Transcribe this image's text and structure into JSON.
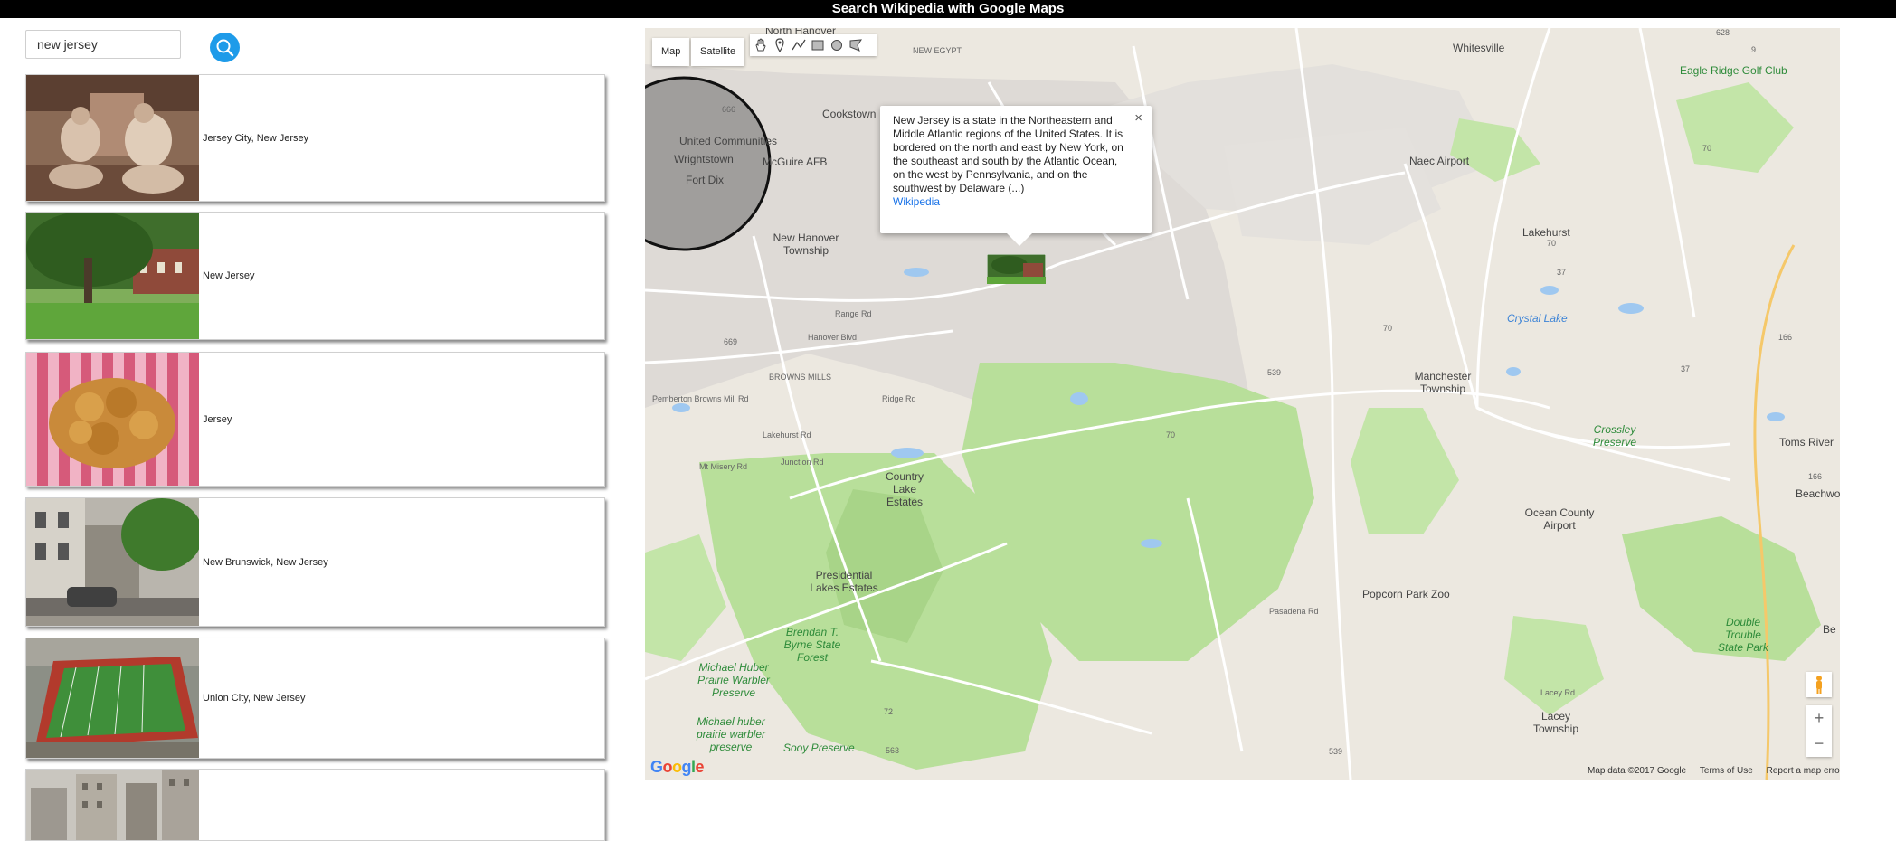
{
  "app": {
    "title": "Search Wikipedia with Google Maps"
  },
  "search": {
    "value": "new jersey",
    "button_icon": "search-icon"
  },
  "results": [
    {
      "label": "Jersey City, New Jersey",
      "thumb": "sepia-family-photo"
    },
    {
      "label": "New Jersey",
      "thumb": "tree-lawn-photo"
    },
    {
      "label": "Jersey",
      "thumb": "fried-food-photo"
    },
    {
      "label": "New Brunswick, New Jersey",
      "thumb": "street-photo"
    },
    {
      "label": "Union City, New Jersey",
      "thumb": "stadium-aerial-photo"
    },
    {
      "label": "",
      "thumb": "city-buildings-photo"
    }
  ],
  "map": {
    "type_controls": {
      "map": "Map",
      "satellite": "Satellite",
      "selected": "Map"
    },
    "draw_tools": [
      "hand-icon",
      "marker-icon",
      "polyline-icon",
      "rectangle-icon",
      "circle-icon",
      "polygon-icon"
    ],
    "infowindow": {
      "text": "New Jersey is a state in the Northeastern and Middle Atlantic regions of the United States. It is bordered on the north and east by New York, on the southeast and south by the Atlantic Ocean, on the west by Pennsylvania, and on the southwest by Delaware (...)",
      "link": "Wikipedia",
      "close": "×"
    },
    "labels": {
      "north_hanover": "North Hanover",
      "new_egypt": "NEW EGYPT",
      "cookstown": "Cookstown",
      "united_communities": "United Communities",
      "wrightstown": "Wrightstown",
      "mcguire": "McGuire AFB",
      "fort_dix": "Fort Dix",
      "new_hanover": "New Hanover Township",
      "browns_mills": "BROWNS MILLS",
      "country_lake": "Country Lake Estates",
      "presidential": "Presidential Lakes Estates",
      "brendan": "Brendan T. Byrne State Forest",
      "michael_huber": "Michael Huber Prairie Warbler Preserve",
      "michael_huber2": "Michael huber prairie warbler preserve",
      "sooy": "Sooy Preserve",
      "whitesville": "Whitesville",
      "eagle_ridge": "Eagle Ridge Golf Club",
      "naec": "Naec Airport",
      "lakehurst": "Lakehurst",
      "crystal": "Crystal Lake",
      "manchester": "Manchester Township",
      "crossley": "Crossley Preserve",
      "ocean_county": "Ocean County Airport",
      "toms_river": "Toms River",
      "beachwood": "Beachwo",
      "popcorn": "Popcorn Park Zoo",
      "double_trouble": "Double Trouble State Park",
      "lacey": "Lacey Township",
      "be": "Be"
    },
    "road_labels": {
      "r666": "666",
      "r669": "669",
      "r628": "628",
      "r9": "9",
      "r70a": "70",
      "r70b": "70",
      "r70c": "70",
      "r70d": "70",
      "r37a": "37",
      "r37b": "37",
      "r539a": "539",
      "r539b": "539",
      "r563": "563",
      "r72": "72",
      "r166a": "166",
      "r166b": "166",
      "range_rd": "Range Rd",
      "hanover_blvd": "Hanover Blvd",
      "lakehurst_rd": "Lakehurst Rd",
      "pemberton": "Pemberton Browns Mill Rd",
      "ridge_rd": "Ridge Rd",
      "mt_misery": "Mt Misery Rd",
      "junction_rd": "Junction Rd",
      "lacey_rd": "Lacey Rd",
      "pasadena": "Pasadena Rd"
    },
    "footer": {
      "data": "Map data ©2017 Google",
      "terms": "Terms of Use",
      "report": "Report a map error"
    },
    "zoom": {
      "in": "+",
      "out": "−"
    },
    "logo": "Google"
  }
}
